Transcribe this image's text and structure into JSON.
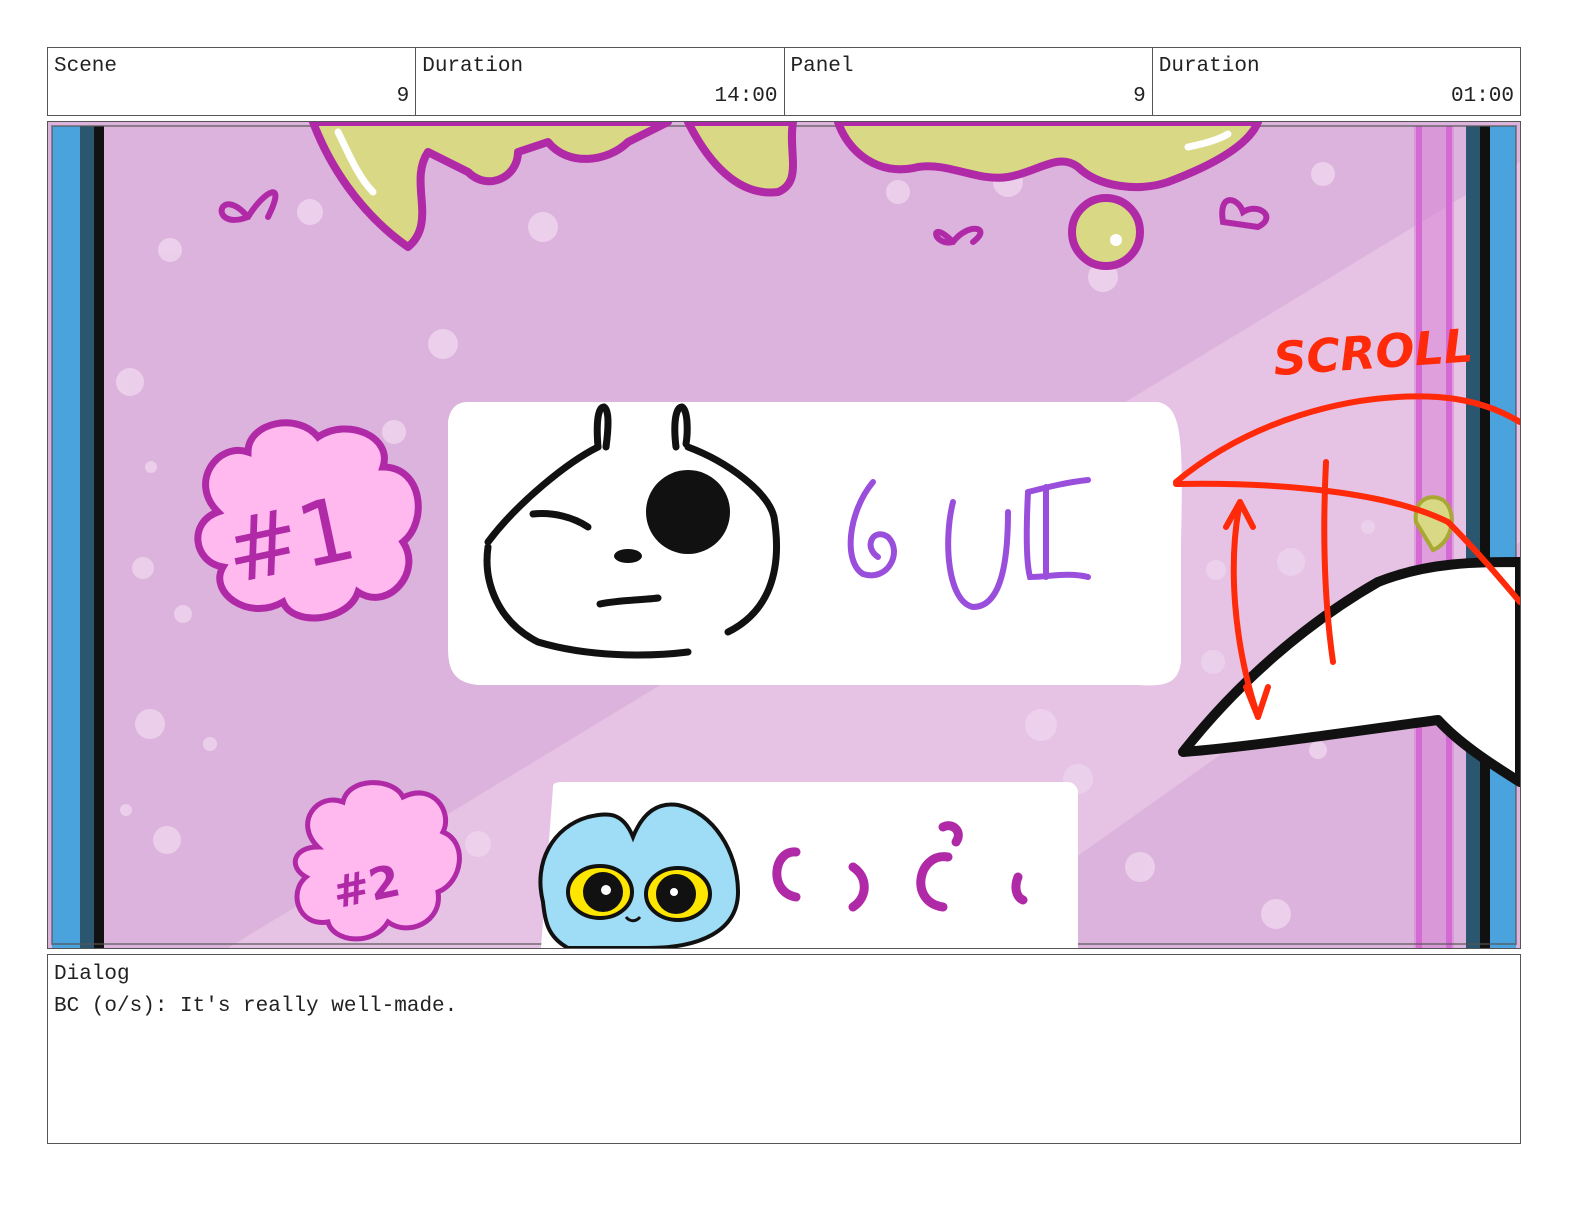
{
  "header": {
    "scene_label": "Scene",
    "scene_value": "9",
    "scene_duration_label": "Duration",
    "scene_duration_value": "14:00",
    "panel_label": "Panel",
    "panel_value": "9",
    "panel_duration_label": "Duration",
    "panel_duration_value": "01:00"
  },
  "artwork": {
    "badge_1": "#1",
    "badge_2": "#2",
    "scroll_note": "SCROLL",
    "colors": {
      "background": "#dcb3dc",
      "border_blue": "#4aa3dd",
      "badge_pink": "#ffb9ee",
      "badge_stroke": "#b02aa8",
      "annotation_red": "#ff2a0a",
      "title_yellow": "#d9d884"
    }
  },
  "dialog": {
    "label": "Dialog",
    "text": "BC (o/s): It's really well-made."
  }
}
